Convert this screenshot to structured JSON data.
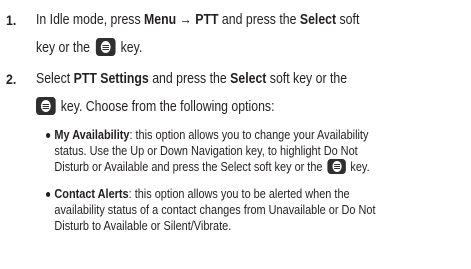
{
  "step1": {
    "number": "1.",
    "line1": {
      "a": "In Idle mode, press ",
      "b": "Menu → PTT",
      "c": " and press the ",
      "d": "Select",
      "e": " soft"
    },
    "line2": {
      "a": "key or the ",
      "b": " key."
    }
  },
  "step2": {
    "number": "2.",
    "line1": {
      "a": "Select ",
      "b": "PTT Settings",
      "c": " and press the ",
      "d": "Select",
      "e": " soft key or the"
    },
    "line2": {
      "b": " key. Choose from the following options:"
    }
  },
  "bullets": [
    {
      "term": "My Availability",
      "l1": ": this option allows you to change your Availability",
      "l2": "status. Use the Up or Down Navigation key, to highlight Do Not",
      "l3a": "Disturb or Available and press the Select soft key or the ",
      "l3b": " key."
    },
    {
      "term": "Contact Alerts",
      "l1": ": this option allows you to be alerted when the",
      "l2": "availability status of a contact changes from Unavailable or Do Not",
      "l3": "Disturb to Available or Silent/Vibrate."
    }
  ],
  "icons": {
    "ok_key": "menu-ok-key-icon"
  }
}
